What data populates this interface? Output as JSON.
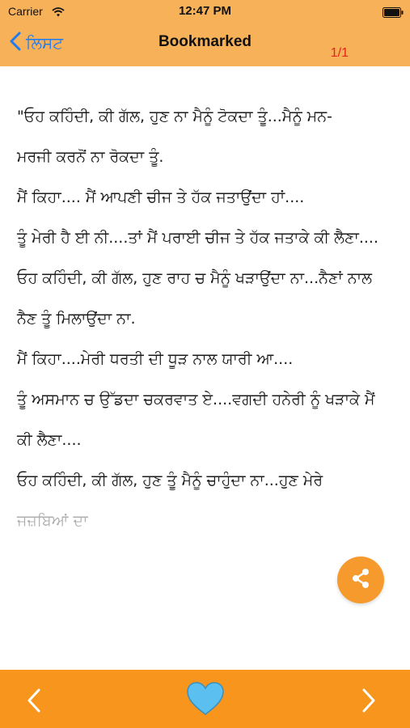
{
  "status_bar": {
    "carrier": "Carrier",
    "time": "12:47 PM",
    "icons": [
      "wifi-icon",
      "battery-icon"
    ]
  },
  "nav": {
    "back_label": "ਲਿਸਟ",
    "title": "Bookmarked",
    "page_counter": "1/1",
    "colors": {
      "bar": "#f7b159",
      "back": "#1f7bf2",
      "counter": "#e0251b"
    }
  },
  "content": {
    "paragraphs": [
      "\"ਓਹ ਕਹਿੰਦੀ, ਕੀ ਗੱਲ, ਹੁਣ ਨਾ ਮੈਨੂੰ ਟੋਕਦਾ ਤੂੰ...ਮੈਨੂੰ ਮਨ-",
      "ਮਰਜੀ ਕਰਨੋਂ ਨਾ ਰੋਕਦਾ ਤੂੰ.",
      "ਮੈਂ ਕਿਹਾ.... ਮੈਂ ਆਪਣੀ ਚੀਜ ਤੇ ਹੱਕ ਜਤਾਉਂਦਾ ਹਾਂ....",
      "ਤੂੰ ਮੇਰੀ ਹੈ ਈ ਨੀ....ਤਾਂ ਮੈਂ ਪਰਾਈ ਚੀਜ ਤੇ ਹੱਕ ਜਤਾਕੇ ਕੀ ਲੈਣਾ....",
      "ਓਹ ਕਹਿੰਦੀ, ਕੀ ਗੱਲ, ਹੁਣ ਰਾਹ ਚ ਮੈਨੂੰ ਖੜਾਉਂਦਾ ਨਾ...ਨੈਣਾਂ ਨਾਲ",
      "ਨੈਣ ਤੂੰ ਮਿਲਾਉਂਦਾ ਨਾ.",
      "ਮੈਂ ਕਿਹਾ....ਮੇਰੀ ਧਰਤੀ ਦੀ ਧੂੜ ਨਾਲ ਯਾਰੀ ਆ....",
      "ਤੂੰ ਅਸਮਾਨ ਚ ਉੱਡਦਾ ਚਕਰਵਾਤ ਏ....ਵਗਦੀ ਹਨੇਰੀ ਨੂੰ ਖੜਾਕੇ ਮੈਂ",
      "ਕੀ ਲੈਣਾ....",
      "ਓਹ ਕਹਿੰਦੀ, ਕੀ ਗੱਲ, ਹੁਣ ਤੂੰ ਮੈਨੂੰ ਚਾਹੁੰਦਾ ਨਾ...ਹੁਣ ਮੇਰੇ",
      "ਜਜ਼ਬਿਆਂ ਦਾ"
    ]
  },
  "actions": {
    "share": "share-icon",
    "prev": "chevron-left-icon",
    "bookmark": "heart-icon",
    "next": "chevron-right-icon",
    "colors": {
      "toolbar": "#f7951c",
      "fab": "#f79a2d",
      "heart": "#5bc0f0"
    }
  }
}
